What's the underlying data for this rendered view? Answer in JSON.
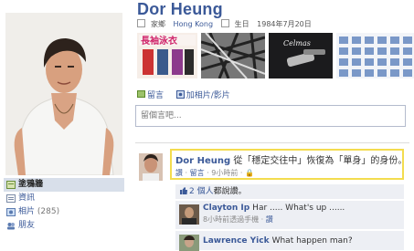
{
  "profile": {
    "name": "Dor Heung",
    "hometown_label": "家鄉",
    "hometown": "Hong Kong",
    "birthday_label": "生日",
    "birthday": "1984年7月20日"
  },
  "left_nav": {
    "items": [
      {
        "label": "塗鴉牆",
        "count": "",
        "active": true
      },
      {
        "label": "資訊",
        "count": ""
      },
      {
        "label": "相片",
        "count": "(285)"
      },
      {
        "label": "朋友",
        "count": ""
      }
    ]
  },
  "photo_strip": {
    "banner_text": "長袖泳衣"
  },
  "publisher": {
    "tab_post": "留言",
    "tab_photo": "加相片/影片",
    "placeholder": "留個言吧..."
  },
  "story": {
    "author": "Dor Heung",
    "text": "從「穩定交往中」恢復為「單身」的身份。",
    "meta_like": "讚",
    "meta_comment": "留言",
    "meta_time": "9小時前",
    "meta_sep": "·"
  },
  "likes": {
    "text": "2 個人",
    "suffix": "都說讚。"
  },
  "comments": [
    {
      "name": "Clayton Ip",
      "text": "Har ..... What's up ......",
      "meta": "8小時前透過手機",
      "meta_link": "讚"
    },
    {
      "name": "Lawrence Yick",
      "text": "What happen man?",
      "meta": "",
      "meta_link": ""
    }
  ],
  "colors": {
    "link_blue": "#3b5998",
    "highlight_border": "#f3dc4f",
    "feed_bg": "#edeff4"
  }
}
